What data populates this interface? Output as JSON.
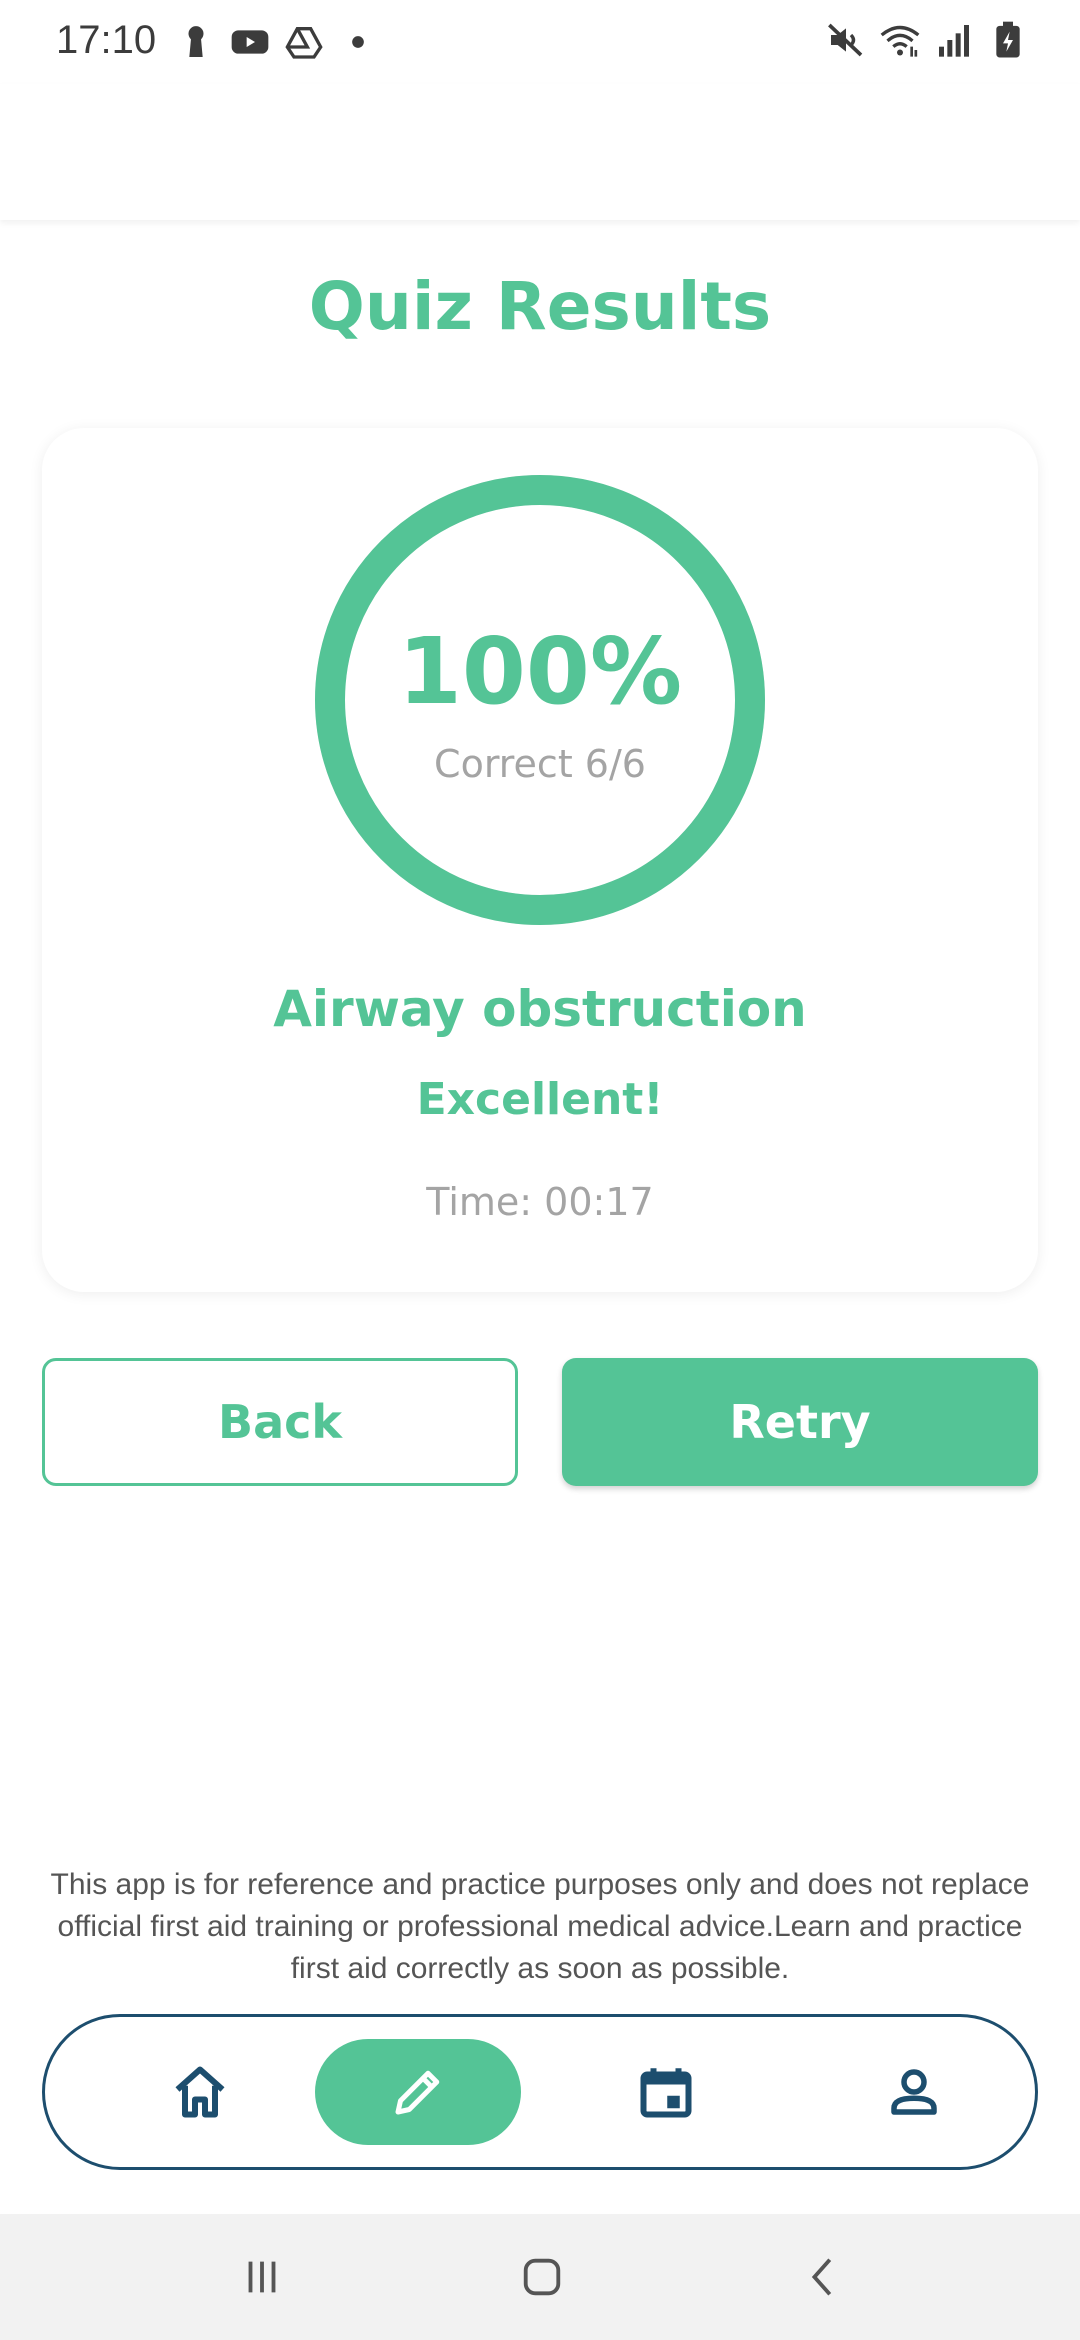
{
  "status_bar": {
    "time": "17:10",
    "left_icons": [
      "keyhole-icon",
      "youtube-icon",
      "drive-icon",
      "dot-icon"
    ],
    "right_icons": [
      "mute-icon",
      "wifi-icon",
      "signal-icon",
      "battery-icon"
    ]
  },
  "page": {
    "title": "Quiz Results"
  },
  "result": {
    "percent_text": "100%",
    "score_fraction": 1.0,
    "correct_text": "Correct 6/6",
    "topic": "Airway obstruction",
    "rating": "Excellent!",
    "time_text": "Time: 00:17"
  },
  "actions": {
    "back_label": "Back",
    "retry_label": "Retry"
  },
  "disclaimer": "This app is for reference and practice purposes only and does not replace official first aid training or professional medical advice.Learn and practice first aid correctly as soon as possible.",
  "bottom_nav": {
    "items": [
      {
        "icon": "home-icon",
        "active": false
      },
      {
        "icon": "pencil-icon",
        "active": true
      },
      {
        "icon": "calendar-icon",
        "active": false
      },
      {
        "icon": "person-icon",
        "active": false
      }
    ]
  },
  "system_nav": {
    "icons": [
      "recent-apps-icon",
      "home-button-icon",
      "back-arrow-icon"
    ]
  },
  "colors": {
    "accent": "#54c496",
    "nav_border": "#1d4e6e",
    "muted_text": "#a4a4a4"
  }
}
